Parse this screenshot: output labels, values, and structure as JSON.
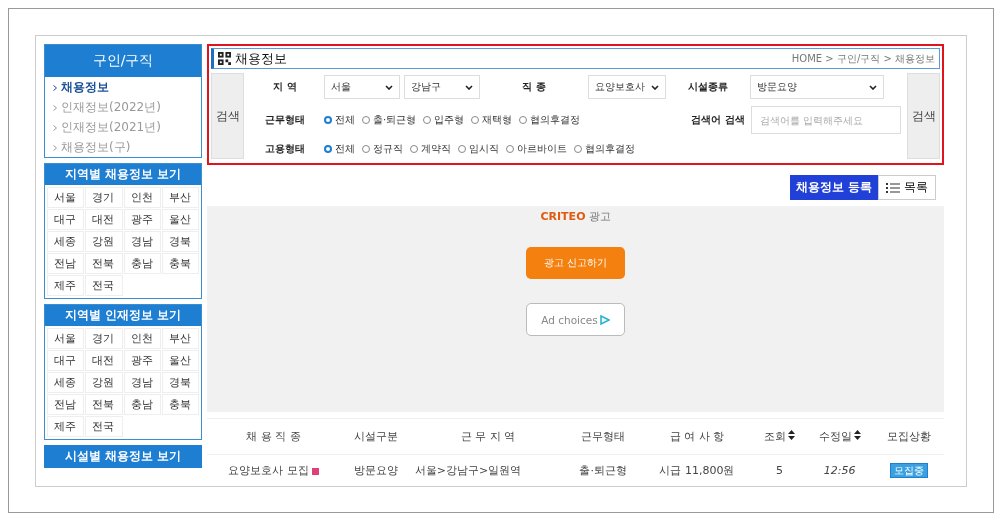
{
  "sidebar": {
    "title": "구인/구직",
    "items": [
      {
        "label": "채용정보",
        "selected": true
      },
      {
        "label": "인재정보(2022년)",
        "selected": false
      },
      {
        "label": "인재정보(2021년)",
        "selected": false
      },
      {
        "label": "채용정보(구)",
        "selected": false
      }
    ],
    "region_boxes": [
      {
        "title": "지역별 채용정보 보기",
        "regions": [
          "서울",
          "경기",
          "인천",
          "부산",
          "대구",
          "대전",
          "광주",
          "울산",
          "세종",
          "강원",
          "경남",
          "경북",
          "전남",
          "전북",
          "충남",
          "충북",
          "제주",
          "전국"
        ]
      },
      {
        "title": "지역별 인재정보 보기",
        "regions": [
          "서울",
          "경기",
          "인천",
          "부산",
          "대구",
          "대전",
          "광주",
          "울산",
          "세종",
          "강원",
          "경남",
          "경북",
          "전남",
          "전북",
          "충남",
          "충북",
          "제주",
          "전국"
        ]
      }
    ],
    "last_heading": "시설별 채용정보 보기"
  },
  "header": {
    "title": "채용정보",
    "breadcrumb": "HOME > 구인/구직 > 채용정보"
  },
  "search": {
    "button_left": "검색",
    "button_right": "검색",
    "region_label": "지 역",
    "region_values": [
      "서울",
      "강남구"
    ],
    "job_label": "직 종",
    "job_value": "요양보호사",
    "facility_label": "시설종류",
    "facility_value": "방문요양",
    "keyword_label": "검색어 검색",
    "keyword_placeholder": "검색어를 입력해주세요",
    "radio_groups": [
      {
        "label": "근무형태",
        "options": [
          {
            "label": "전체",
            "selected": true
          },
          {
            "label": "출·퇴근형",
            "selected": false
          },
          {
            "label": "입주형",
            "selected": false
          },
          {
            "label": "재택형",
            "selected": false
          },
          {
            "label": "협의후결정",
            "selected": false
          }
        ]
      },
      {
        "label": "고용형태",
        "options": [
          {
            "label": "전체",
            "selected": true
          },
          {
            "label": "정규직",
            "selected": false
          },
          {
            "label": "계약직",
            "selected": false
          },
          {
            "label": "임시직",
            "selected": false
          },
          {
            "label": "아르바이트",
            "selected": false
          },
          {
            "label": "협의후결정",
            "selected": false
          }
        ]
      }
    ]
  },
  "actions": {
    "register": "채용정보 등록",
    "list": "목록"
  },
  "ad": {
    "brand": "CRITEO",
    "brand_suffix": "광고",
    "report_button": "광고 신고하기",
    "choices": "Ad choices"
  },
  "table": {
    "columns": [
      "채 용 직 종",
      "시설구분",
      "근 무 지 역",
      "근무형태",
      "급 여 사 항",
      "조회",
      "수정일",
      "모집상황"
    ],
    "sortable": [
      false,
      false,
      false,
      false,
      false,
      true,
      true,
      false
    ],
    "rows": [
      {
        "cells": [
          "요양보호사 모집",
          "방문요양",
          "서울>강남구>일원역",
          "출·퇴근형",
          "시급 11,800원",
          "5",
          "12:56"
        ],
        "new": true,
        "status": "모집중"
      }
    ]
  }
}
